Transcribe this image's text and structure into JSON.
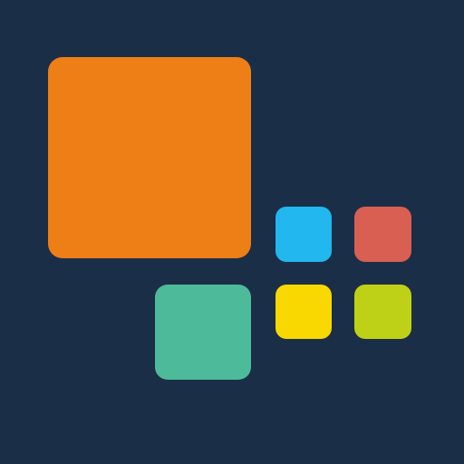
{
  "background": "#1b2e48",
  "tiles": [
    {
      "id": "tile-orange",
      "name": "large-orange-tile",
      "color": "#ee7e16"
    },
    {
      "id": "tile-teal",
      "name": "teal-tile",
      "color": "#4dbb99"
    },
    {
      "id": "tile-blue",
      "name": "blue-tile",
      "color": "#22b7ee"
    },
    {
      "id": "tile-red",
      "name": "red-tile",
      "color": "#d95f53"
    },
    {
      "id": "tile-yellow",
      "name": "yellow-tile",
      "color": "#f8d800"
    },
    {
      "id": "tile-lime",
      "name": "lime-tile",
      "color": "#bfd116"
    }
  ]
}
